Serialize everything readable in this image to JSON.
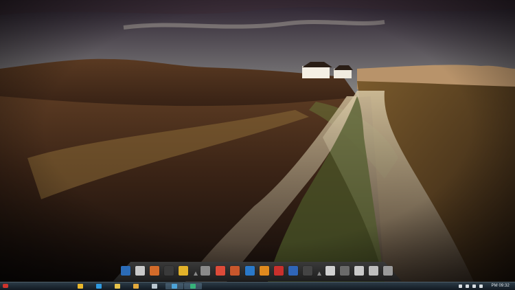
{
  "desktop": {
    "wallpaper_name": "coastal-dune-road-landscape"
  },
  "dock": {
    "icons": [
      {
        "name": "computer-icon",
        "color": "#2b6cb8"
      },
      {
        "name": "equalizer-icon",
        "color": "#c9c9c9"
      },
      {
        "name": "speaker-icon",
        "color": "#d36b2a"
      },
      {
        "name": "media-player-icon",
        "color": "#3a3a3a"
      },
      {
        "name": "downloader-icon",
        "color": "#e2b22a"
      },
      {
        "name": "apple-icon",
        "color": "#8a8a8a"
      },
      {
        "name": "chrome-icon",
        "color": "#dd4b39"
      },
      {
        "name": "image-viewer-icon",
        "color": "#c8572c"
      },
      {
        "name": "paint-icon",
        "color": "#2a79c9"
      },
      {
        "name": "packager-icon",
        "color": "#e08a1e"
      },
      {
        "name": "pdf-icon",
        "color": "#c9302c"
      },
      {
        "name": "word-icon",
        "color": "#2f65b8"
      },
      {
        "name": "terminal-icon",
        "color": "#444444"
      },
      {
        "name": "network-icon",
        "color": "#d0d0d0"
      },
      {
        "name": "film-icon",
        "color": "#6a6a6a"
      },
      {
        "name": "equalizer-2-icon",
        "color": "#c9c9c9"
      },
      {
        "name": "settings-icon",
        "color": "#bdbdbd"
      },
      {
        "name": "recycle-bin-icon",
        "color": "#9a9a9a"
      }
    ]
  },
  "taskbar": {
    "items": [
      {
        "name": "chrome-taskbar-icon",
        "color": "#e9b72b",
        "active": false
      },
      {
        "name": "ie-taskbar-icon",
        "color": "#2f9ae0",
        "active": false
      },
      {
        "name": "explorer-taskbar-icon",
        "color": "#e7c34a",
        "active": false
      },
      {
        "name": "media-taskbar-icon",
        "color": "#e3a93c",
        "active": false
      },
      {
        "name": "app-taskbar-icon",
        "color": "#b8c6d0",
        "active": false
      },
      {
        "name": "display-taskbar-icon",
        "color": "#4da3d8",
        "active": true
      },
      {
        "name": "utility-taskbar-icon",
        "color": "#37b27a",
        "active": true
      }
    ],
    "clock": "PM 09:32"
  }
}
